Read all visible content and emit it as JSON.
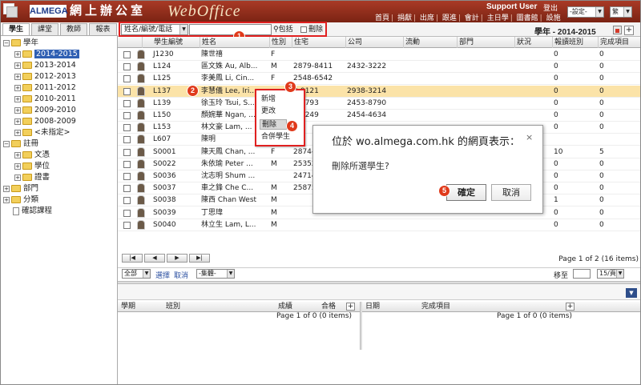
{
  "header": {
    "brand": "ALMEGA",
    "portal_name": "網上辦公室",
    "app_title": "WebOffice",
    "user": "Support User",
    "logout": "登出",
    "nav": [
      "首頁",
      "捐獻",
      "出席",
      "跟進",
      "會計",
      "主日學",
      "圖書館",
      "設施"
    ],
    "role_select": "-設定-",
    "lang_select": "繁"
  },
  "tabs": [
    "學生",
    "課堂",
    "教師",
    "報表"
  ],
  "tree": {
    "root_year": "學年",
    "years": [
      "2014-2015",
      "2013-2014",
      "2012-2013",
      "2011-2012",
      "2010-2011",
      "2009-2010",
      "2008-2009",
      "<未指定>"
    ],
    "registry": "註冊",
    "registry_children": [
      "文憑",
      "學位",
      "證書"
    ],
    "dept": "部門",
    "category": "分類",
    "confirm_course": "確認課程"
  },
  "toolbar": {
    "field_select": "姓名/編號/電話",
    "search_value": "",
    "search_button": "包括",
    "delete_label": "刪除",
    "year_title": "學年 - 2014-2015",
    "add_label": "+"
  },
  "grid": {
    "columns": [
      "學生編號",
      "姓名",
      "性別",
      "住宅",
      "公司",
      "流動",
      "部門",
      "狀況",
      "報讀班別",
      "完成項目"
    ],
    "rows": [
      [
        "J1230",
        "陳世禧",
        "F",
        "",
        "",
        "",
        "",
        "",
        "0",
        "0"
      ],
      [
        "L124",
        "區文姝 Au, Alb...",
        "M",
        "2879-8411",
        "2432-3222",
        "",
        "",
        "",
        "0",
        "0"
      ],
      [
        "L125",
        "李美鳳 Li, Cin...",
        "F",
        "2548-6542",
        "",
        "",
        "",
        "",
        "0",
        "0"
      ],
      [
        "L137",
        "李慧儀 Lee, Iri...",
        "",
        "2-9121",
        "2938-3214",
        "",
        "",
        "",
        "0",
        "0"
      ],
      [
        "L139",
        "徐玉玲 Tsui, S...",
        "",
        "3-8793",
        "2453-8790",
        "",
        "",
        "",
        "0",
        "0"
      ],
      [
        "L150",
        "顏婉華 Ngan, ...",
        "",
        "3-3249",
        "2454-4634",
        "",
        "",
        "",
        "0",
        "0"
      ],
      [
        "L153",
        "林文豪 Lam, ...",
        "",
        "",
        "",
        "",
        "",
        "",
        "0",
        "0"
      ],
      [
        "L607",
        "陳明",
        "",
        "",
        "",
        "",
        "",
        "",
        "",
        ""
      ],
      [
        "S0001",
        "陳天鳳 Chan, ...",
        "F",
        "2874-",
        "",
        "",
        "",
        "",
        "10",
        "5"
      ],
      [
        "S0022",
        "朱依瑜 Peter ...",
        "M",
        "25352",
        "",
        "",
        "",
        "",
        "0",
        "0"
      ],
      [
        "S0036",
        "沈志明 Shum ...",
        "",
        "24714",
        "",
        "",
        "",
        "",
        "0",
        "0"
      ],
      [
        "S0037",
        "車之鋒 Che C...",
        "M",
        "25875",
        "",
        "",
        "",
        "",
        "0",
        "0"
      ],
      [
        "S0038",
        "陳西 Chan West",
        "M",
        "",
        "",
        "",
        "",
        "",
        "1",
        "0"
      ],
      [
        "S0039",
        "丁思瑋",
        "M",
        "",
        "",
        "",
        "",
        "",
        "0",
        "0"
      ],
      [
        "S0040",
        "林立生 Lam, L...",
        "M",
        "",
        "",
        "",
        "",
        "",
        "0",
        "0"
      ]
    ]
  },
  "pager": {
    "buttons": [
      "|◀",
      "◀",
      "▶",
      "▶|"
    ],
    "info": "Page 1 of 2 (16 items)",
    "select_all": "全部",
    "select_label": "選擇",
    "cancel_label": "取消",
    "group_select": "-集體-",
    "page_label": "移至",
    "page_size": "15/頁"
  },
  "lower_left": {
    "columns": [
      "學期",
      "班別",
      "成績",
      "合格"
    ],
    "page_info": "Page 1 of 0 (0 items)"
  },
  "lower_right": {
    "columns": [
      "日期",
      "完成項目"
    ],
    "page_info": "Page 1 of 0 (0 items)"
  },
  "context_menu": {
    "items": [
      "新增",
      "更改",
      "刪除",
      "合併學生"
    ],
    "selected": "刪除"
  },
  "dialog": {
    "title": "位於 wo.almega.com.hk 的網頁表示：",
    "message": "刪除所選學生?",
    "ok": "確定",
    "cancel": "取消",
    "close": "×"
  },
  "callouts": [
    "1",
    "2",
    "3",
    "4",
    "5"
  ],
  "colors": {
    "header_bg": "#8d2a17",
    "highlight_row": "#fbe3a8",
    "tree_selected": "#2f5fb3",
    "callout_red": "#e03a1b"
  }
}
